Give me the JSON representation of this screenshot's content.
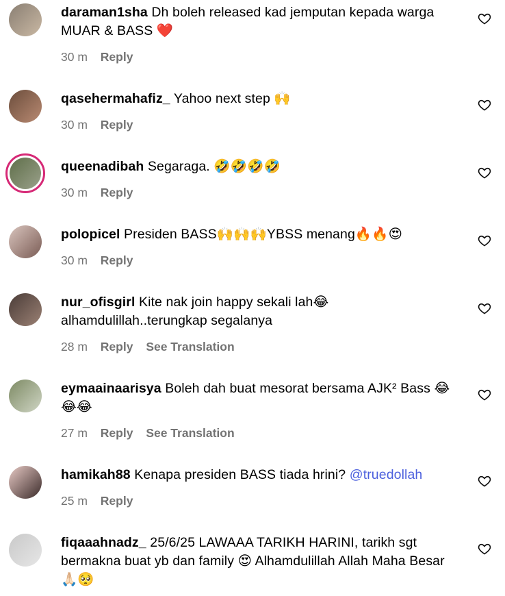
{
  "comments": [
    {
      "username": "daraman1sha",
      "text": "Dh boleh released kad jemputan kepada warga MUAR & BASS ❤️",
      "time": "30 m",
      "reply": "Reply",
      "avatar_colors": [
        "#8a7f73",
        "#c9b8a3"
      ]
    },
    {
      "username": "qasehermahafiz_",
      "text": "Yahoo next step 🙌",
      "time": "30 m",
      "reply": "Reply",
      "avatar_colors": [
        "#6b4d3c",
        "#b98a72"
      ]
    },
    {
      "username": "queenadibah",
      "text": "Segaraga. 🤣🤣🤣🤣",
      "time": "30 m",
      "reply": "Reply",
      "avatar_colors": [
        "#5f6f4a",
        "#9aa08a"
      ]
    },
    {
      "username": "polopicel",
      "text": "Presiden BASS🙌🙌🙌YBSS menang🔥🔥😍",
      "time": "30 m",
      "reply": "Reply",
      "avatar_colors": [
        "#d9c4bd",
        "#7a5c55"
      ]
    },
    {
      "username": "nur_ofisgirl",
      "text": "Kite nak join happy sekali lah😂 alhamdulillah..terungkap segalanya",
      "time": "28 m",
      "reply": "Reply",
      "translation": "See Translation",
      "avatar_colors": [
        "#4a3c38",
        "#9b8174"
      ]
    },
    {
      "username": "eymaainaarisya",
      "text": "Boleh dah buat mesorat bersama AJK² Bass 😂😂😂",
      "time": "27 m",
      "reply": "Reply",
      "translation": "See Translation",
      "avatar_colors": [
        "#7d8a64",
        "#cfd5c4"
      ]
    },
    {
      "username": "hamikah88",
      "text": "Kenapa presiden BASS tiada hrini?",
      "mention": "@truedollah",
      "time": "25 m",
      "reply": "Reply",
      "avatar_colors": [
        "#e7c9c4",
        "#3b2b2a"
      ]
    },
    {
      "username": "fiqaaahnadz_",
      "text": "25/6/25 LAWAAA TARIKH HARINI, tarikh sgt bermakna buat yb dan family 😍 Alhamdulillah Allah Maha Besar 🙏🏻🥺",
      "avatar_colors": [
        "#c9c9c9",
        "#e6e6e6"
      ]
    }
  ],
  "colors": {
    "meta_text": "#737373",
    "mention": "#4b5fdd",
    "story_ring": "#d62976"
  }
}
